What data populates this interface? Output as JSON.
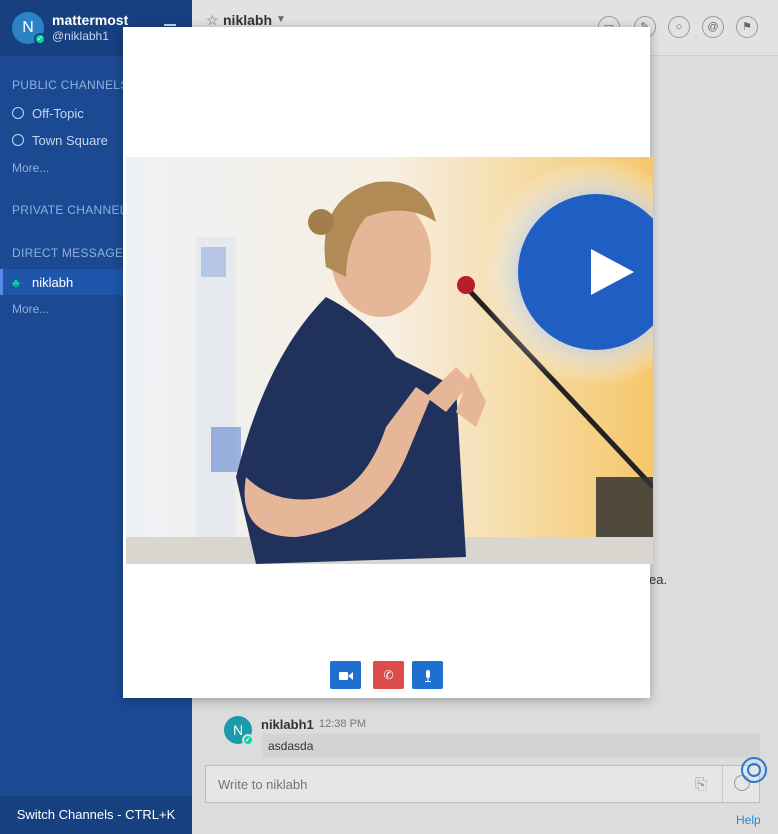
{
  "team": {
    "name": "mattermost",
    "username": "@niklabh1",
    "initial": "N"
  },
  "sidebar": {
    "public_header": "PUBLIC CHANNELS",
    "public_channels": [
      {
        "label": "Off-Topic"
      },
      {
        "label": "Town Square"
      }
    ],
    "public_more": "More...",
    "private_header": "PRIVATE CHANNELS",
    "dm_header": "DIRECT MESSAGES",
    "dm_items": [
      {
        "label": "niklabh"
      }
    ],
    "dm_more": "More...",
    "switch_channels": "Switch Channels - CTRL+K"
  },
  "header": {
    "channel_name": "niklabh"
  },
  "messages": {
    "partial_text": "ea.",
    "post": {
      "initial": "N",
      "username": "niklabh1",
      "time": "12:38 PM",
      "text": "asdasda"
    }
  },
  "composer": {
    "placeholder": "Write to niklabh"
  },
  "help": "Help",
  "call_controls": [
    {
      "name": "video-toggle-button",
      "icon": "video-camera-icon",
      "color": "#1f6fd1"
    },
    {
      "name": "hangup-button",
      "icon": "phone-hangup-icon",
      "color": "#dd4b4b"
    },
    {
      "name": "mute-button",
      "icon": "microphone-icon",
      "color": "#1f6fd1"
    }
  ],
  "colors": {
    "sidebar": "#1b4a93",
    "accent": "#1f6fd1",
    "danger": "#dd4b4b",
    "online": "#06d6a0"
  }
}
